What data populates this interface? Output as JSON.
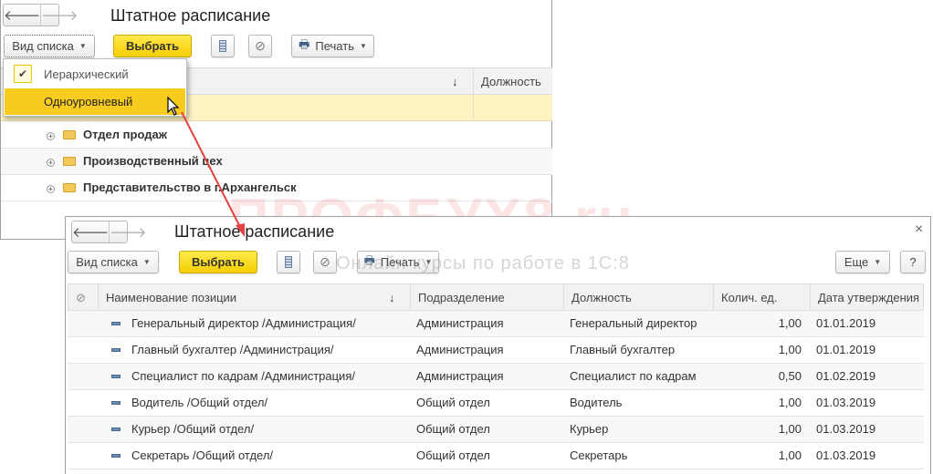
{
  "watermark": {
    "brand": "ПРОФБУХ8.ru",
    "tagline": "Онлайн курсы по работе в 1С:8"
  },
  "back_window": {
    "title": "Штатное расписание",
    "toolbar": {
      "view_list": "Вид списка",
      "select": "Выбрать",
      "print": "Печать"
    },
    "dropdown": {
      "items": [
        {
          "label": "Иерархический",
          "checked": true
        },
        {
          "label": "Одноуровневый",
          "highlighted": true
        }
      ]
    },
    "columns": {
      "sort_arrow": "↓",
      "position": "Должность"
    },
    "groups": [
      "Отдел продаж",
      "Производственный цех",
      "Представительство в г.Архангельск"
    ]
  },
  "front_window": {
    "title": "Штатное расписание",
    "close": "×",
    "toolbar": {
      "view_list": "Вид списка",
      "select": "Выбрать",
      "print": "Печать",
      "more": "Еще",
      "help": "?"
    },
    "columns": {
      "name": "Наименование позиции",
      "sort_arrow": "↓",
      "department": "Подразделение",
      "position": "Должность",
      "quantity": "Колич. ед.",
      "date": "Дата утверждения"
    },
    "rows": [
      {
        "name": "Генеральный директор /Администрация/",
        "department": "Администрация",
        "position": "Генеральный директор",
        "quantity": "1,00",
        "date": "01.01.2019"
      },
      {
        "name": "Главный бухгалтер /Администрация/",
        "department": "Администрация",
        "position": "Главный бухгалтер",
        "quantity": "1,00",
        "date": "01.01.2019"
      },
      {
        "name": "Специалист по кадрам /Администрация/",
        "department": "Администрация",
        "position": "Специалист по кадрам",
        "quantity": "0,50",
        "date": "01.02.2019"
      },
      {
        "name": "Водитель /Общий отдел/",
        "department": "Общий отдел",
        "position": "Водитель",
        "quantity": "1,00",
        "date": "01.03.2019"
      },
      {
        "name": "Курьер /Общий отдел/",
        "department": "Общий отдел",
        "position": "Курьер",
        "quantity": "1,00",
        "date": "01.03.2019"
      },
      {
        "name": "Секретарь /Общий отдел/",
        "department": "Общий отдел",
        "position": "Секретарь",
        "quantity": "1,00",
        "date": "01.03.2019"
      }
    ]
  },
  "colors": {
    "accent_yellow": "#f5cf00",
    "highlight_row": "#fff3c4",
    "arrow": "#e84040"
  }
}
